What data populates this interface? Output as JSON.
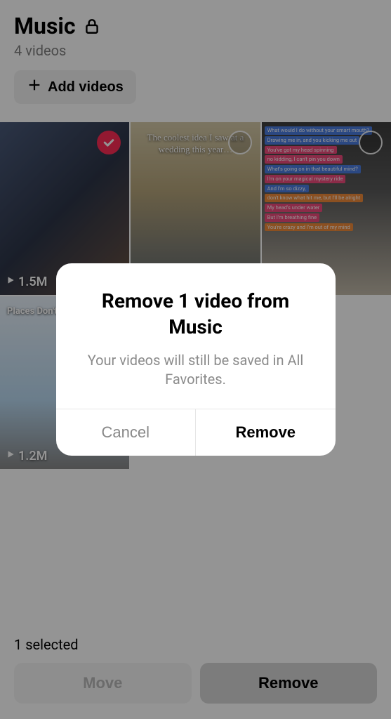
{
  "header": {
    "title": "Music",
    "subtitle": "4 videos",
    "add_button_label": "Add videos"
  },
  "videos": [
    {
      "views": "1.5M",
      "selected": true,
      "caption": ""
    },
    {
      "views": "",
      "selected": false,
      "caption": "The coolest idea I saw at a wedding this year…"
    },
    {
      "views": "",
      "selected": false,
      "caption": "",
      "lyrics": [
        {
          "text": "What would I do without your smart mouth?",
          "cls": "lt-blue"
        },
        {
          "text": "Drawing me in, and you kicking me out",
          "cls": "lt-blue"
        },
        {
          "text": "You've got my head spinning",
          "cls": "lt-pink"
        },
        {
          "text": "no kidding, I can't pin you down",
          "cls": "lt-pink"
        },
        {
          "text": "What's going on in that beautiful mind?",
          "cls": "lt-blue"
        },
        {
          "text": "I'm on your magical mystery ride",
          "cls": "lt-pink"
        },
        {
          "text": "And I'm so dizzy,",
          "cls": "lt-blue"
        },
        {
          "text": "don't know what hit me, but I'll be alright",
          "cls": "lt-orange"
        },
        {
          "text": "My head's under water",
          "cls": "lt-pink"
        },
        {
          "text": "But I'm breathing fine",
          "cls": "lt-pink"
        },
        {
          "text": "You're crazy and I'm out of my mind",
          "cls": "lt-orange"
        }
      ]
    },
    {
      "views": "1.2M",
      "selected": false,
      "caption": "Places Don't F"
    }
  ],
  "bottom_bar": {
    "selected_label": "1 selected",
    "move_label": "Move",
    "remove_label": "Remove"
  },
  "dialog": {
    "title": "Remove 1 video from Music",
    "description": "Your videos will still be saved in All Favorites.",
    "cancel_label": "Cancel",
    "confirm_label": "Remove"
  }
}
